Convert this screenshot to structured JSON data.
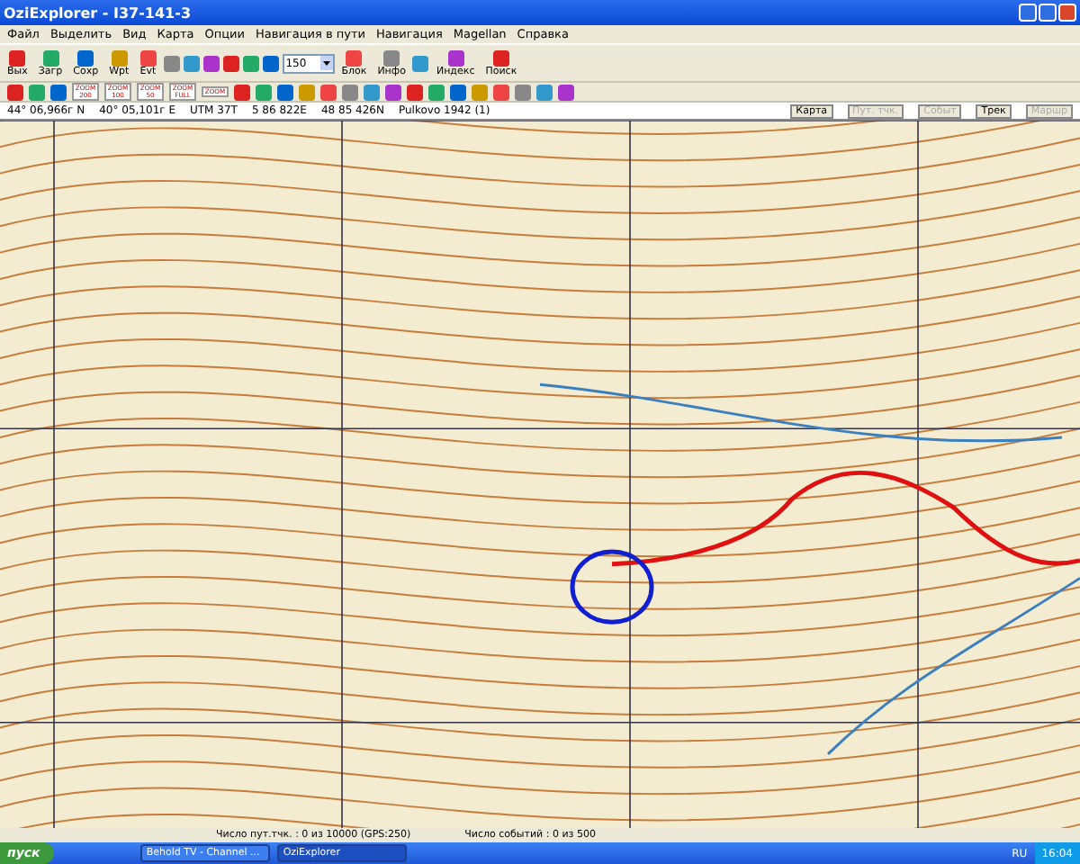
{
  "window": {
    "title": "OziExplorer - I37-141-3"
  },
  "menu": [
    "Файл",
    "Выделить",
    "Вид",
    "Карта",
    "Опции",
    "Навигация в пути",
    "Навигация",
    "Magellan",
    "Справка"
  ],
  "toolbar": [
    {
      "kind": "labeled",
      "label": "Вых"
    },
    {
      "kind": "labeled",
      "label": "Загр"
    },
    {
      "kind": "labeled",
      "label": "Сохр"
    },
    {
      "kind": "labeled",
      "label": "Wpt"
    },
    {
      "kind": "labeled",
      "label": "Evt"
    },
    {
      "kind": "icon"
    },
    {
      "kind": "icon"
    },
    {
      "kind": "icon"
    },
    {
      "kind": "icon"
    },
    {
      "kind": "icon"
    },
    {
      "kind": "icon"
    },
    {
      "kind": "combo",
      "label": "150"
    },
    {
      "kind": "labeled",
      "label": "Блок"
    },
    {
      "kind": "labeled",
      "label": "Инфо"
    },
    {
      "kind": "icon"
    },
    {
      "kind": "labeled",
      "label": "Индекс"
    },
    {
      "kind": "labeled",
      "label": "Поиск"
    }
  ],
  "toolbar2": [
    {
      "kind": "icon"
    },
    {
      "kind": "icon"
    },
    {
      "kind": "icon"
    },
    {
      "kind": "zoom",
      "label": "ZOOM 200"
    },
    {
      "kind": "zoom",
      "label": "ZOOM 100"
    },
    {
      "kind": "zoom",
      "label": "ZOOM 50"
    },
    {
      "kind": "zoom",
      "label": "ZOOM FULL"
    },
    {
      "kind": "zoom",
      "label": "ZOOM"
    },
    {
      "kind": "icon"
    },
    {
      "kind": "icon"
    },
    {
      "kind": "icon"
    },
    {
      "kind": "icon"
    },
    {
      "kind": "icon"
    },
    {
      "kind": "icon"
    },
    {
      "kind": "icon"
    },
    {
      "kind": "icon"
    },
    {
      "kind": "icon"
    },
    {
      "kind": "icon"
    },
    {
      "kind": "icon"
    },
    {
      "kind": "icon"
    },
    {
      "kind": "icon"
    },
    {
      "kind": "icon"
    },
    {
      "kind": "icon"
    },
    {
      "kind": "icon"
    }
  ],
  "coords": [
    "44° 06,966г N",
    "40° 05,101г E",
    "UTM 37T",
    "5 86 822E",
    "48 85 426N",
    "Pulkovo 1942 (1)"
  ],
  "view_tabs": [
    {
      "label": "Карта",
      "disabled": false
    },
    {
      "label": "Пут. тчк.",
      "disabled": true
    },
    {
      "label": "Событ",
      "disabled": true
    },
    {
      "label": "Трек",
      "disabled": false
    },
    {
      "label": "Маршр",
      "disabled": true
    }
  ],
  "status_bar": [
    "Число пут.тчк. : 0 из 10000  (GPS:250)",
    "Число событий : 0 из 500"
  ],
  "taskbar": {
    "start": "пуск",
    "tasks": [
      {
        "label": "Behold TV - Channel ...",
        "selected": false
      },
      {
        "label": "OziExplorer",
        "selected": true
      }
    ],
    "language": "RU",
    "time": "16:04"
  }
}
